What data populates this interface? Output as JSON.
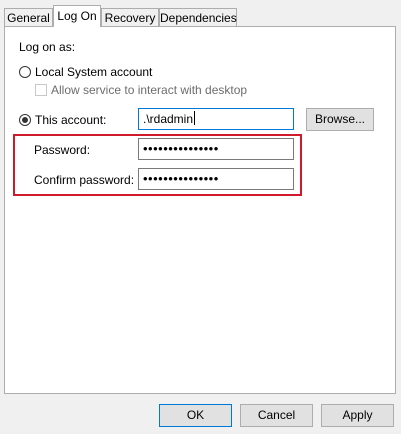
{
  "tabs": [
    "General",
    "Log On",
    "Recovery",
    "Dependencies"
  ],
  "logon": {
    "heading": "Log on as:",
    "local_system_label": "Local System account",
    "allow_desktop_label": "Allow service to interact with desktop",
    "this_account_label": "This account:",
    "account_value": ".\\rdadmin",
    "browse_label": "Browse...",
    "password_label": "Password:",
    "password_value": "•••••••••••••••",
    "confirm_label": "Confirm password:",
    "confirm_value": "•••••••••••••••",
    "selected_option": "this-account",
    "allow_desktop_checked": false
  },
  "footer": {
    "ok_label": "OK",
    "cancel_label": "Cancel",
    "apply_label": "Apply"
  },
  "colors": {
    "highlight": "#d0192b",
    "focus": "#0078d7"
  }
}
